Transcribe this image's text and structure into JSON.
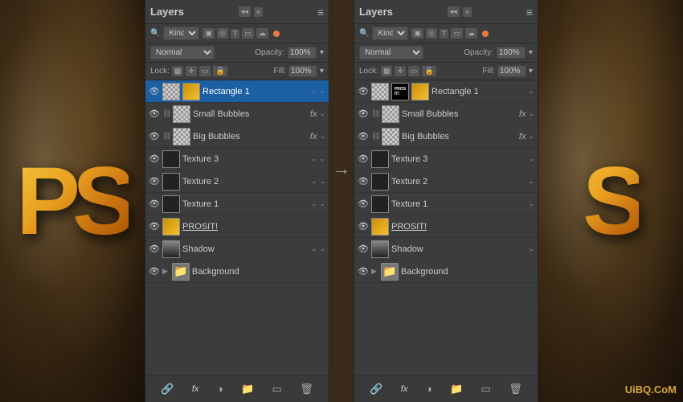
{
  "leftPanel": {
    "title": "Layers",
    "kindLabel": "Kind",
    "blendMode": "Normal",
    "opacityLabel": "Opacity:",
    "opacityValue": "100%",
    "lockLabel": "Lock:",
    "fillLabel": "Fill:",
    "fillValue": "100%",
    "layers": [
      {
        "name": "Rectangle 1",
        "type": "shape",
        "hasChevron": true,
        "selected": true
      },
      {
        "name": "Small Bubbles",
        "type": "checkerboard",
        "hasFx": true,
        "hasChain": true
      },
      {
        "name": "Big Bubbles",
        "type": "checkerboard",
        "hasFx": true,
        "hasChain": true
      },
      {
        "name": "Texture 3",
        "type": "dark",
        "hasChevron": true
      },
      {
        "name": "Texture 2",
        "type": "dark",
        "hasChevron": true
      },
      {
        "name": "Texture 1",
        "type": "dark",
        "hasChevron": true
      },
      {
        "name": "PROSIT!",
        "type": "gold",
        "underline": true
      },
      {
        "name": "Shadow",
        "type": "shadow",
        "hasChevron": true
      },
      {
        "name": "Background",
        "type": "folder",
        "isFolder": true
      }
    ],
    "footer": {
      "link": "🔗",
      "fx": "fx",
      "adjustment": "◑",
      "folder": "📁",
      "mask": "▭",
      "delete": "🗑"
    }
  },
  "rightPanel": {
    "title": "Layers",
    "kindLabel": "Kind",
    "blendMode": "Normal",
    "opacityLabel": "Opacity:",
    "opacityValue": "100%",
    "lockLabel": "Lock:",
    "fillLabel": "Fill:",
    "fillValue": "100%",
    "layers": [
      {
        "name": "Rectangle 1",
        "type": "shape",
        "hasChevron": false,
        "selected": false,
        "hasExtra": true
      },
      {
        "name": "Small Bubbles",
        "type": "checkerboard",
        "hasFx": true,
        "hasChain": true
      },
      {
        "name": "Big Bubbles",
        "type": "checkerboard",
        "hasFx": true,
        "hasChain": true
      },
      {
        "name": "Texture 3",
        "type": "dark",
        "hasChevron": false
      },
      {
        "name": "Texture 2",
        "type": "dark",
        "hasChevron": false
      },
      {
        "name": "Texture 1",
        "type": "dark",
        "hasChevron": false
      },
      {
        "name": "PROSIT!",
        "type": "gold",
        "underline": true
      },
      {
        "name": "Shadow",
        "type": "shadow",
        "hasChevron": false
      },
      {
        "name": "Background",
        "type": "folder",
        "isFolder": true
      }
    ],
    "footer": {
      "link": "🔗",
      "fx": "fx",
      "adjustment": "◑",
      "folder": "📁",
      "mask": "▭",
      "delete": "🗑"
    }
  },
  "arrow": "→",
  "watermark": "UiBQ.CoM"
}
